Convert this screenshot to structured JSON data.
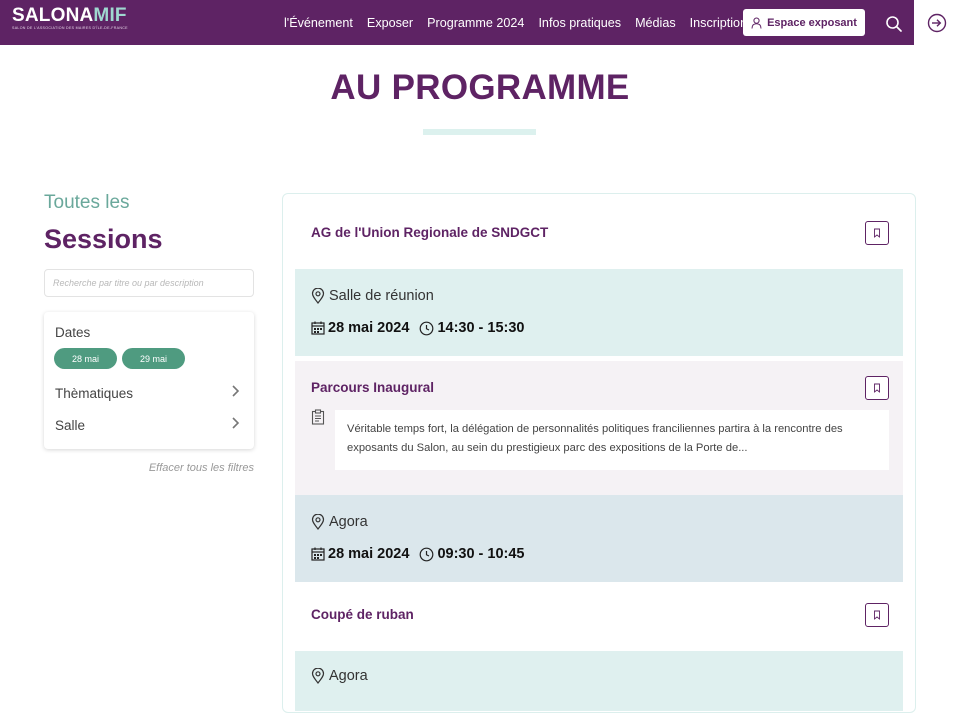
{
  "nav": {
    "logo_main": "SALONA",
    "logo_accent": "MIF",
    "logo_sub": "SALON DE L'ASSOCIATION DES MAIRES D'ÎLE-DE-FRANCE",
    "links": [
      "l'Événement",
      "Exposer",
      "Programme 2024",
      "Infos pratiques",
      "Médias",
      "Inscription"
    ],
    "exhibitor_button": "Espace exposant",
    "icons": {
      "search": "search-icon",
      "login": "sign-in-icon",
      "user": "user-icon"
    }
  },
  "page": {
    "title": "AU PROGRAMME"
  },
  "sidebar": {
    "pre_title": "Toutes les",
    "title": "Sessions",
    "search_placeholder": "Recherche par titre ou par description",
    "filters": {
      "dates_label": "Dates",
      "dates": [
        "28 mai",
        "29 mai"
      ],
      "themes_label": "Thèmatiques",
      "room_label": "Salle"
    },
    "clear_filters": "Effacer tous les filtres"
  },
  "sessions": [
    {
      "title": "AG de l'Union Regionale de SNDGCT",
      "location": "Salle de réunion",
      "date": "28 mai 2024",
      "time": "14:30 - 15:30"
    },
    {
      "title": "Parcours Inaugural",
      "description": "Véritable temps fort, la délégation de personnalités politiques franciliennes partira à la rencontre des exposants du Salon, au sein du prestigieux parc des expositions de la Porte de...",
      "location": "Agora",
      "date": "28 mai 2024",
      "time": "09:30 - 10:45"
    },
    {
      "title": "Coupé de ruban",
      "location": "Agora"
    }
  ],
  "colors": {
    "brand_purple": "#5e2364",
    "mint_accent": "#9fd8d0",
    "green_chip": "#4f9b80",
    "info_bg_1": "#dff0ef",
    "info_bg_2": "#dbe7ec",
    "desc_bg": "#f5f2f5"
  }
}
